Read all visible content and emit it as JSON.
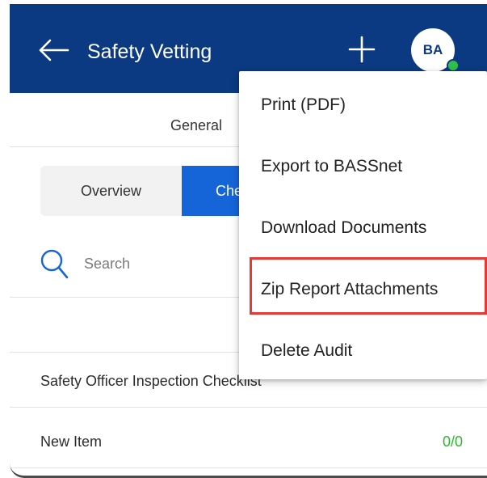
{
  "header": {
    "title": "Safety Vetting",
    "avatar_initials": "BA"
  },
  "tabs": {
    "general": "General"
  },
  "segments": {
    "overview": "Overview",
    "checklist": "Checklist"
  },
  "search": {
    "placeholder": "Search"
  },
  "list": {
    "rows": [
      {
        "label": "Safety Officer Inspection Checklist"
      },
      {
        "label": "New Item",
        "count": "0/0"
      }
    ]
  },
  "menu": {
    "items": [
      "Print (PDF)",
      "Export to BASSnet",
      "Download Documents",
      "Zip Report Attachments",
      "Delete Audit"
    ]
  },
  "colors": {
    "header_bg": "#0b3a82",
    "accent": "#1565d8",
    "count_green": "#2eb82e",
    "highlight_red": "#e53935",
    "presence_green": "#2fbf4a"
  }
}
